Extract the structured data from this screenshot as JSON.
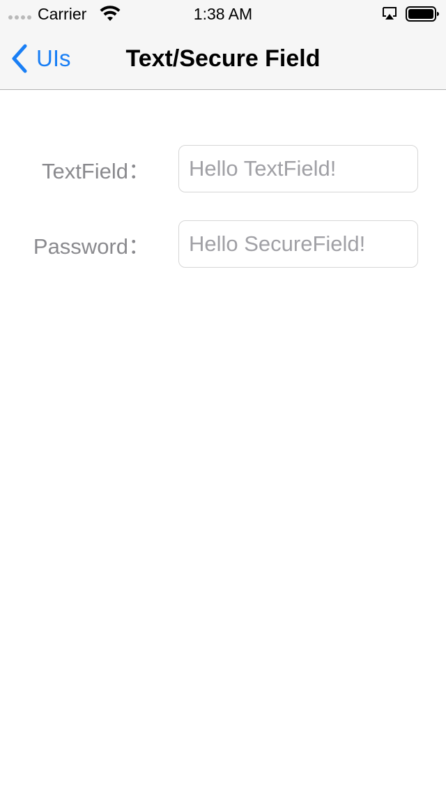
{
  "status_bar": {
    "carrier": "Carrier",
    "time": "1:38 AM",
    "icons": [
      "signal-dots",
      "wifi-icon",
      "airplay-icon",
      "battery-icon"
    ]
  },
  "nav_bar": {
    "back_label": "UIs",
    "title": "Text/Secure Field",
    "back_icon": "chevron-left-icon",
    "accent_color": "#1a7ff5"
  },
  "form": {
    "text_field": {
      "label": "TextField：",
      "value": "",
      "placeholder": "Hello TextField!"
    },
    "password_field": {
      "label": "Password：",
      "value": "",
      "placeholder": "Hello SecureField!"
    }
  }
}
